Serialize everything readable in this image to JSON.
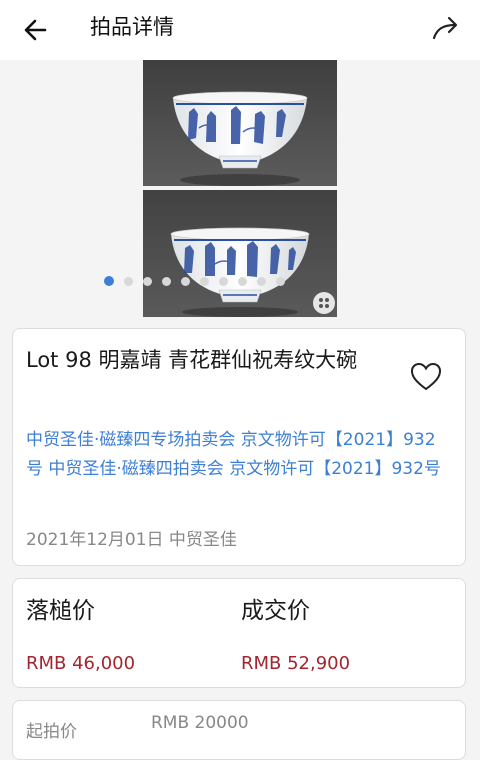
{
  "header": {
    "title": "拍品详情",
    "back_icon": "arrow-left-icon",
    "share_icon": "share-arrow-icon"
  },
  "gallery": {
    "image_count": 10,
    "active_index": 0,
    "accent": "#3d7fd6"
  },
  "lot": {
    "title": "Lot 98 明嘉靖 青花群仙祝寿纹大碗",
    "description": "中贸圣佳·磁臻四专场拍卖会 京文物许可【2021】932号 中贸圣佳·磁臻四拍卖会 京文物许可【2021】932号",
    "date_source": "2021年12月01日 中贸圣佳",
    "favorite_icon": "heart-outline-icon"
  },
  "prices": {
    "hammer_label": "落槌价",
    "hammer_value": "RMB 46,000",
    "final_label": "成交价",
    "final_value": "RMB 52,900",
    "value_color": "#a32530"
  },
  "start": {
    "label": "起拍价",
    "value": "RMB 20000"
  }
}
